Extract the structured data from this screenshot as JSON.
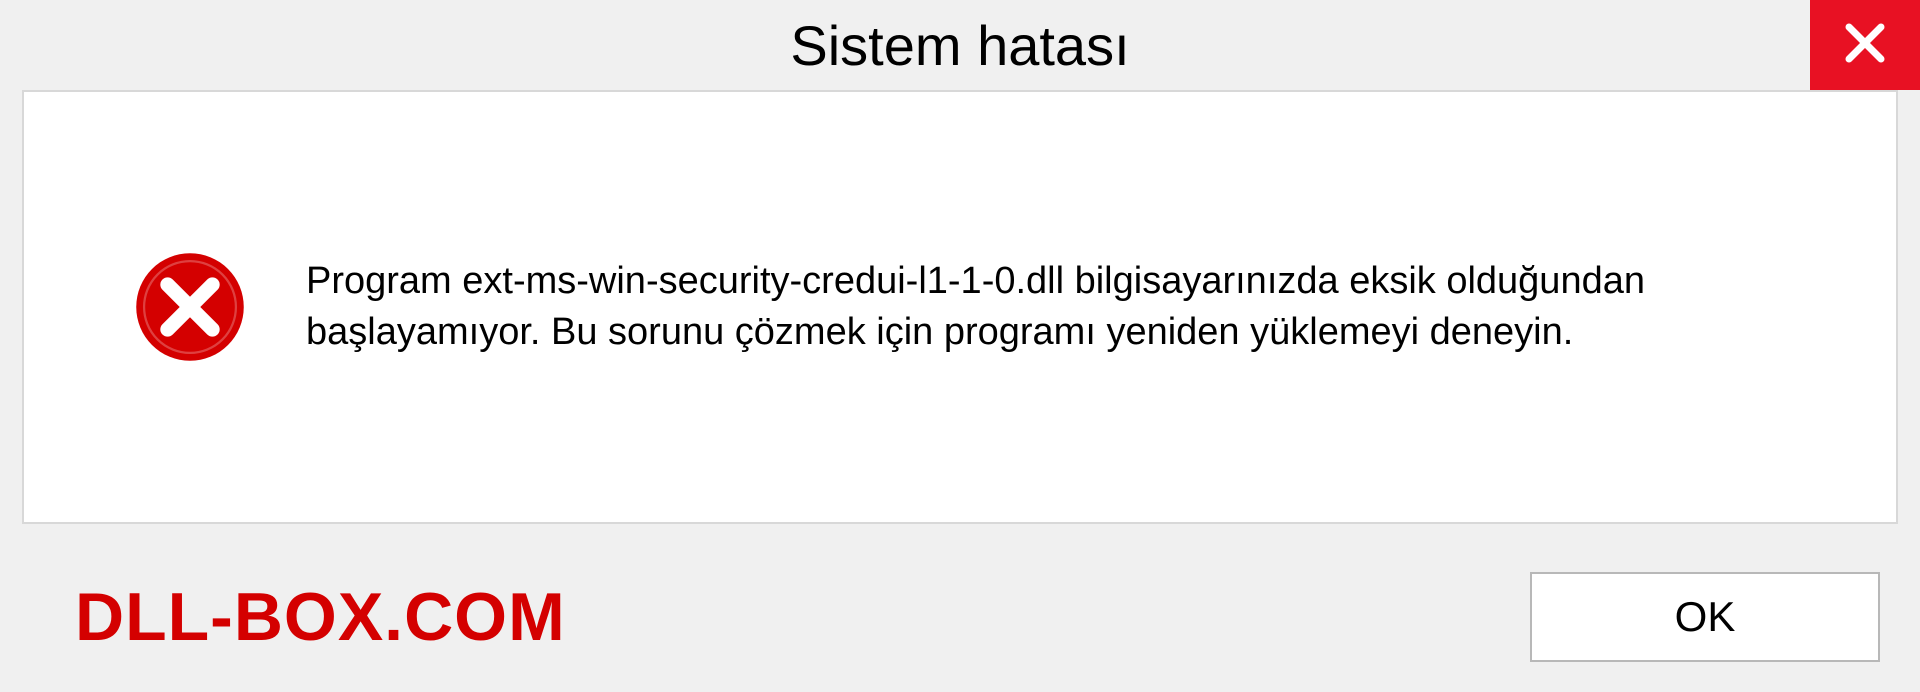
{
  "dialog": {
    "title": "Sistem hatası",
    "message": "Program ext-ms-win-security-credui-l1-1-0.dll bilgisayarınızda eksik olduğundan başlayamıyor. Bu sorunu çözmek için programı yeniden yüklemeyi deneyin.",
    "ok_label": "OK"
  },
  "watermark": {
    "text": "DLL-BOX.COM"
  }
}
